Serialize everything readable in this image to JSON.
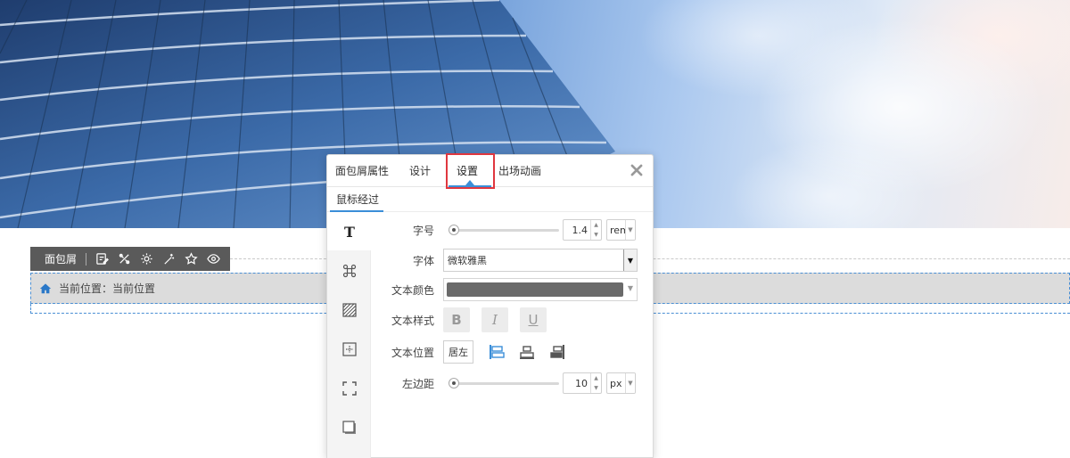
{
  "colors": {
    "accent": "#3b8ed8",
    "highlight": "#e0373f",
    "toolbar_bg": "#5a5a5a",
    "text_color_value": "#6a6a6a"
  },
  "module": {
    "toolbar_label": "面包屑",
    "toolbar_icons": [
      "edit-icon",
      "tools-icon",
      "settings-icon",
      "magic-wand-icon",
      "star-icon",
      "eye-icon"
    ],
    "breadcrumb_text": "当前位置：当前位置"
  },
  "panel": {
    "tabs": [
      {
        "label": "面包屑属性"
      },
      {
        "label": "设计"
      },
      {
        "label": "设置"
      },
      {
        "label": "出场动画"
      }
    ],
    "active_tab": "设置",
    "subtab": "鼠标经过",
    "rail_icons": [
      "text-icon",
      "command-icon",
      "texture-icon",
      "layout-icon",
      "border-icon",
      "shadow-icon"
    ],
    "font_size": {
      "label": "字号",
      "value": "1.4",
      "unit": "rem",
      "level": 0
    },
    "font_family": {
      "label": "字体",
      "value": "微软雅黑"
    },
    "text_color": {
      "label": "文本颜色"
    },
    "text_style": {
      "label": "文本样式",
      "bold": "B",
      "italic": "I",
      "underline": "U"
    },
    "text_position": {
      "label": "文本位置",
      "value": "居左"
    },
    "left_padding": {
      "label": "左边距",
      "value": "10",
      "unit": "px",
      "level": 0
    }
  }
}
